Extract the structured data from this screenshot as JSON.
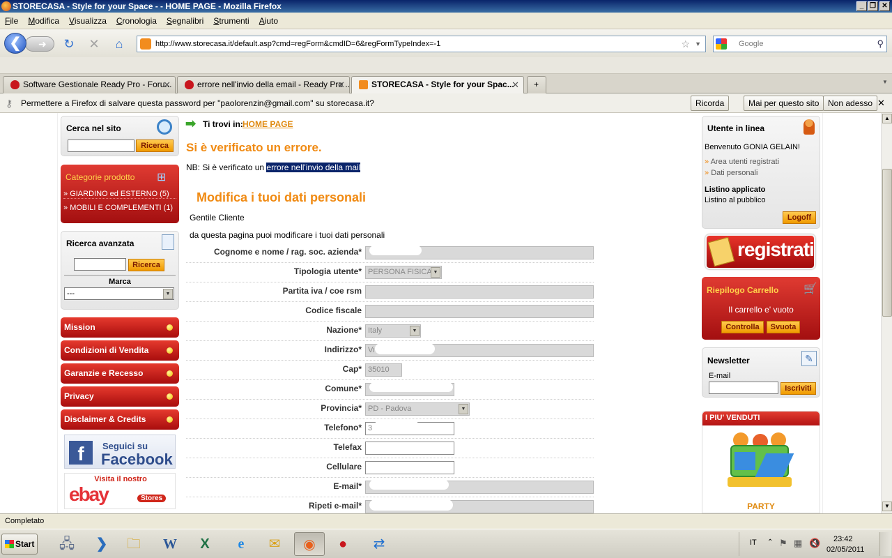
{
  "window": {
    "title": "STORECASA - Style for your Space - - HOME PAGE - Mozilla Firefox",
    "buttons": [
      "_",
      "❐",
      "✕"
    ]
  },
  "menu": [
    {
      "label": "File"
    },
    {
      "label": "Modifica"
    },
    {
      "label": "Visualizza"
    },
    {
      "label": "Cronologia"
    },
    {
      "label": "Segnalibri"
    },
    {
      "label": "Strumenti"
    },
    {
      "label": "Aiuto"
    }
  ],
  "nav": {
    "url": "http://www.storecasa.it/default.asp?cmd=regForm&cmdID=6&regFormTypeIndex=-1",
    "search_placeholder": "Google"
  },
  "tabs": [
    {
      "label": "Software Gestionale Ready Pro - Foru...",
      "icon": "strawberry-icon",
      "active": false
    },
    {
      "label": "errore nell'invio della email - Ready Pro ...",
      "icon": "strawberry-icon",
      "active": false
    },
    {
      "label": "STORECASA - Style for your Spac...",
      "icon": "rss-icon",
      "active": true
    }
  ],
  "password_bar": {
    "message": "Permettere a Firefox di salvare questa password per \"paolorenzin@gmail.com\" su storecasa.it?",
    "remember": "Ricorda",
    "never": "Mai per questo sito",
    "not_now": "Non adesso"
  },
  "left": {
    "search_title": "Cerca nel sito",
    "search_btn": "Ricerca",
    "categories_title": "Categorie prodotto",
    "categories": [
      {
        "label": "GIARDINO ed ESTERNO (5)"
      },
      {
        "label": "MOBILI E COMPLEMENTI (1)"
      }
    ],
    "advanced_title": "Ricerca avanzata",
    "advanced_btn": "Ricerca",
    "brand_label": "Marca",
    "brand_value": "---",
    "menu": [
      {
        "label": "Mission"
      },
      {
        "label": "Condizioni di Vendita"
      },
      {
        "label": "Garanzie e Recesso"
      },
      {
        "label": "Privacy"
      },
      {
        "label": "Disclaimer & Credits"
      }
    ],
    "facebook_line1": "Seguici su",
    "facebook_line2": "Facebook",
    "ebay_line1": "Visita il nostro",
    "ebay_logo": "ebay",
    "ebay_stores": "Stores"
  },
  "main": {
    "breadcrumb_label": "Ti trovi in:",
    "breadcrumb_link": "HOME PAGE",
    "error_title": "Si è verificato un errore.",
    "error_prefix": "NB: Si è verificato un ",
    "error_highlight": "errore nell'invio della mail",
    "form_title": "Modifica i tuoi dati personali",
    "greeting": "Gentile Cliente",
    "intro": "da questa pagina puoi modificare i tuoi dati personali",
    "fields": [
      {
        "label": "Cognome e nome / rag. soc. azienda*",
        "value": ""
      },
      {
        "label": "Tipologia utente*",
        "value": "PERSONA FISICA"
      },
      {
        "label": "Partita iva / coe rsm",
        "value": ""
      },
      {
        "label": "Codice fiscale",
        "value": ""
      },
      {
        "label": "Nazione*",
        "value": "Italy"
      },
      {
        "label": "Indirizzo*",
        "value": "Vi"
      },
      {
        "label": "Cap*",
        "value": "35010"
      },
      {
        "label": "Comune*",
        "value": ""
      },
      {
        "label": "Provincia*",
        "value": "PD - Padova"
      },
      {
        "label": "Telefono*",
        "value": "3"
      },
      {
        "label": "Telefax",
        "value": ""
      },
      {
        "label": "Cellulare",
        "value": ""
      },
      {
        "label": "E-mail*",
        "value": ""
      },
      {
        "label": "Ripeti e-mail*",
        "value": ""
      }
    ]
  },
  "right": {
    "user_title": "Utente in linea",
    "welcome": "Benvenuto GONIA GELAIN!",
    "links": [
      {
        "label": "Area utenti registrati"
      },
      {
        "label": "Dati personali"
      }
    ],
    "pricelist_title": "Listino applicato",
    "pricelist_value": "Listino al pubblico",
    "logoff": "Logoff",
    "register_banner": "registrati",
    "cart_title": "Riepilogo Carrello",
    "cart_empty": "Il carrello e' vuoto",
    "cart_check": "Controlla",
    "cart_clear": "Svuota",
    "newsletter_title": "Newsletter",
    "newsletter_email_label": "E-mail",
    "newsletter_btn": "Iscriviti",
    "bestsellers_title": "I PIU' VENDUTI",
    "bestseller_name": "PARTY"
  },
  "status": "Completato",
  "taskbar": {
    "start": "Start",
    "lang": "IT",
    "time": "23:42",
    "date": "02/05/2011"
  }
}
